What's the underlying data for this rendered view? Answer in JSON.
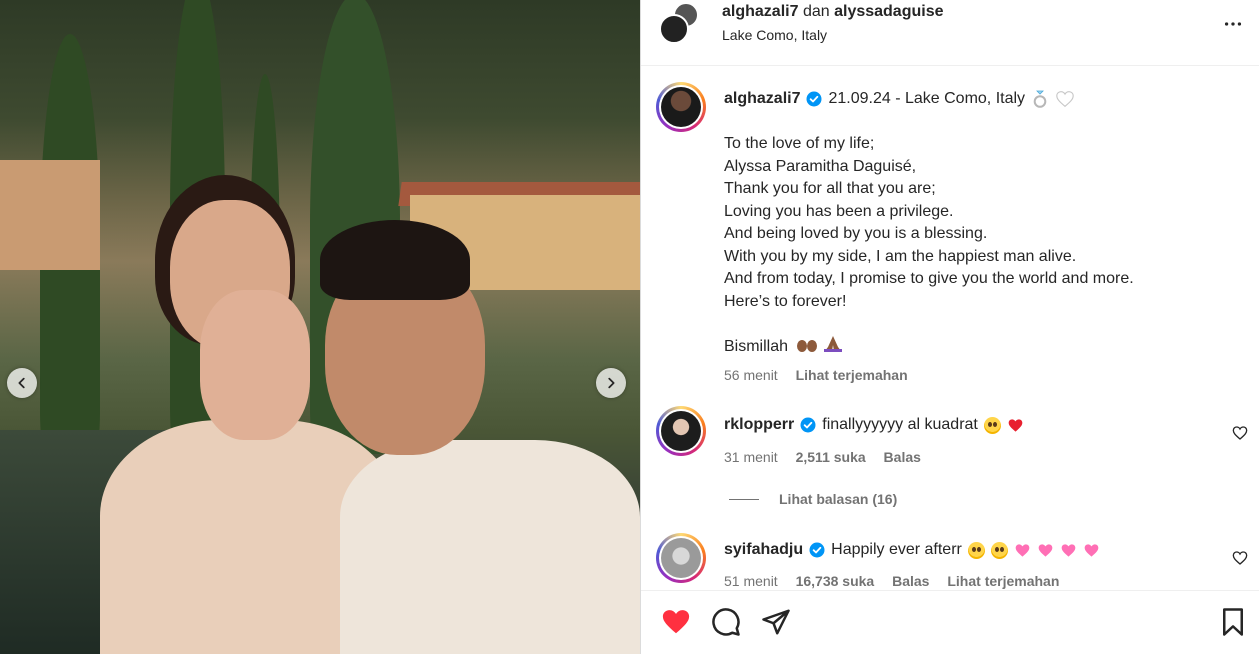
{
  "post": {
    "image_alt": "photo",
    "carousel": {
      "prev_icon": "chevron-left-icon",
      "next_icon": "chevron-right-icon"
    }
  },
  "header": {
    "author": "alghazali7",
    "conjunction": "dan",
    "collaborator": "alyssadaguise",
    "location": "Lake Como, Italy",
    "more_icon": "more-horizontal-icon"
  },
  "caption": {
    "username": "alghazali7",
    "headline": "21.09.24 - Lake Como, Italy",
    "lines": [
      "To the love of my life;",
      "Alyssa Paramitha Daguisé,",
      "Thank you for all that you are;",
      "Loving you has been a privilege.",
      "And being loved by you is a blessing.",
      "With you by my side, I am the happiest man alive.",
      "And from today, I promise to give you the world and more.",
      "Here’s to forever!"
    ],
    "closing": "Bismillah",
    "time": "56 menit",
    "translate": "Lihat terjemahan"
  },
  "comments": [
    {
      "username": "rklopperr",
      "text": "finallyyyyyy al kuadrat",
      "time": "31 menit",
      "likes": "2,511 suka",
      "reply": "Balas",
      "view_replies": "Lihat balasan (16)"
    },
    {
      "username": "syifahadju",
      "text": "Happily ever afterr",
      "time": "51 menit",
      "likes": "16,738 suka",
      "reply": "Balas",
      "translate": "Lihat terjemahan"
    }
  ],
  "colors": {
    "like_red": "#ff3040",
    "verified_blue": "#0095f6",
    "muted_text": "#737373",
    "pink_heart": "#ff6fb5"
  }
}
